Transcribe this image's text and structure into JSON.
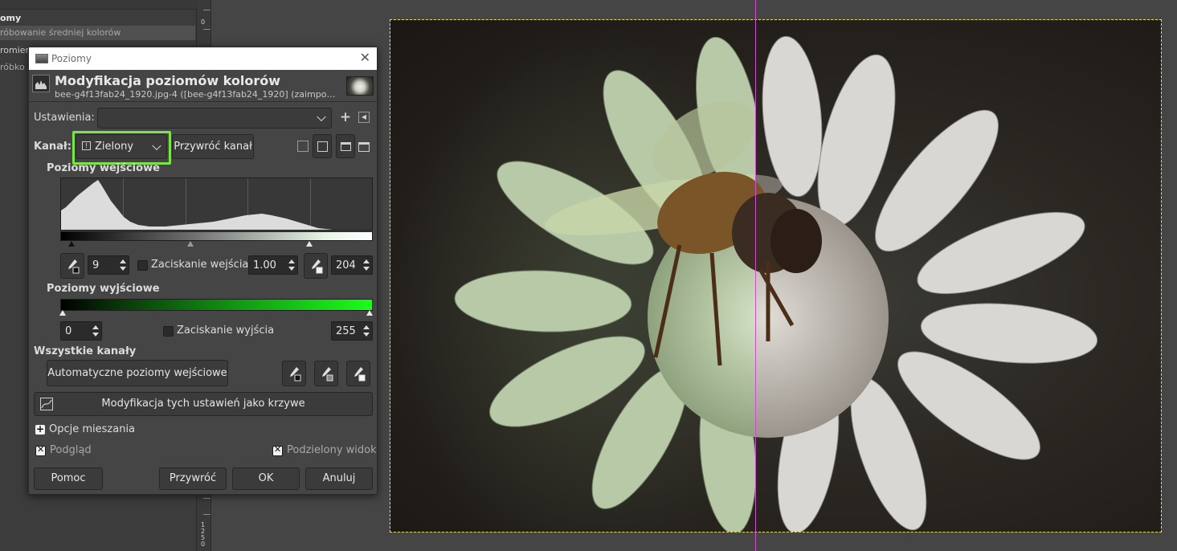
{
  "background_panel": {
    "rows": [
      "omy",
      "róbowanie średniej kolorów",
      "romier",
      "róbko"
    ]
  },
  "ruler": {
    "labels_top": [
      "0"
    ],
    "labels_bottom": [
      "1",
      "2",
      "5",
      "0"
    ]
  },
  "dialog": {
    "window_title": "Poziomy",
    "header_title": "Modyfikacja poziomów kolorów",
    "header_subtitle": "bee-g4f13fab24_1920.jpg-4 ([bee-g4f13fab24_1920] (zaimpo…",
    "settings_label": "Ustawienia:",
    "settings_value": "",
    "channel_label": "Kanał:",
    "channel_value": "Zielony",
    "reset_channel_label": "Przywróć kanał",
    "input_levels_label": "Poziomy wejściowe",
    "input_low": "9",
    "clamp_input_label": "Zaciskanie wejścia",
    "gamma": "1.00",
    "input_high": "204",
    "output_levels_label": "Poziomy wyjściowe",
    "output_low": "0",
    "clamp_output_label": "Zaciskanie wyjścia",
    "output_high": "255",
    "all_channels_label": "Wszystkie kanały",
    "auto_input_label": "Automatyczne poziomy wejściowe",
    "edit_as_curves_label": "Modyfikacja tych ustawień jako krzywe",
    "blend_options_label": "Opcje mieszania",
    "preview_label": "Podgląd",
    "split_view_label": "Podzielony widok",
    "help_label": "Pomoc",
    "reset_label": "Przywróć",
    "ok_label": "OK",
    "cancel_label": "Anuluj",
    "preview_checked": true,
    "split_view_checked": true,
    "clamp_input_checked": false,
    "clamp_output_checked": false
  },
  "colors": {
    "highlight": "#7ce24a",
    "guide": "#d24cd2",
    "selection_marquee": "#e6e055",
    "output_gradient_end": "#19ff19"
  }
}
